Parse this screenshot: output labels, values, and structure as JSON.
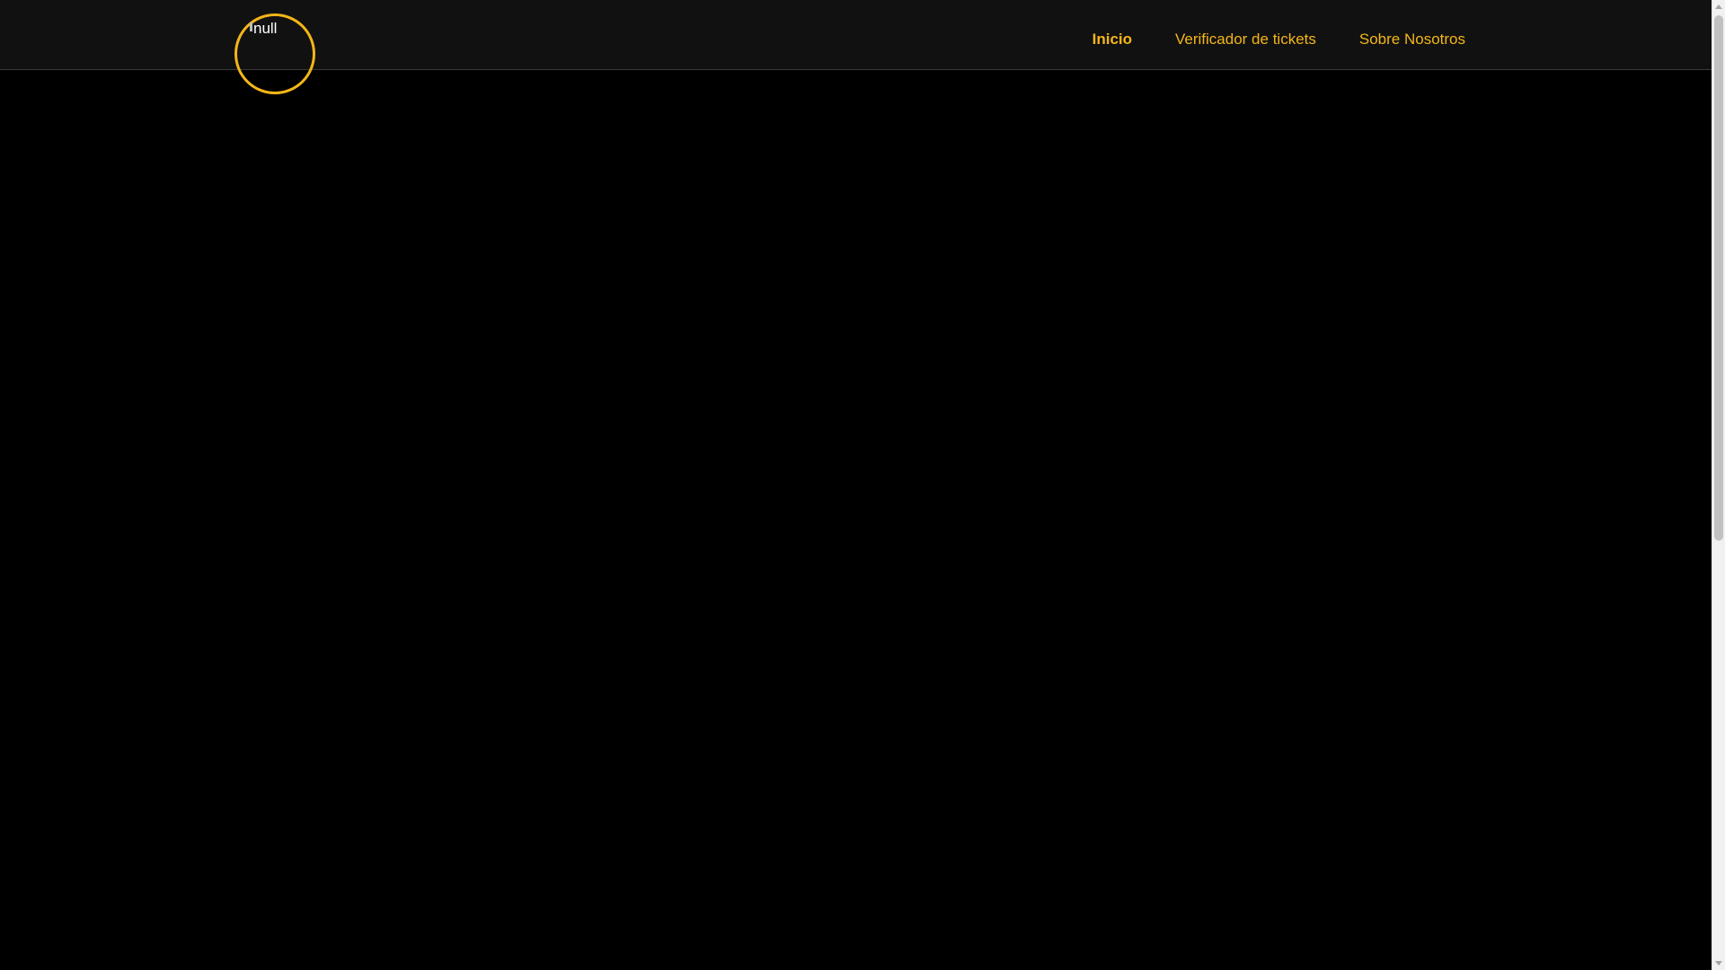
{
  "header": {
    "logo_alt": "null",
    "nav": [
      {
        "label": "Inicio",
        "active": true
      },
      {
        "label": "Verificador de tickets",
        "active": false
      },
      {
        "label": "Sobre Nosotros",
        "active": false
      }
    ]
  },
  "colors": {
    "accent": "#f4b617",
    "navbar_bg": "#111111",
    "page_bg": "#000000"
  },
  "icons": {
    "logo": "broken-image-icon",
    "scroll_up": "triangle-up-icon",
    "scroll_down": "triangle-down-icon"
  }
}
